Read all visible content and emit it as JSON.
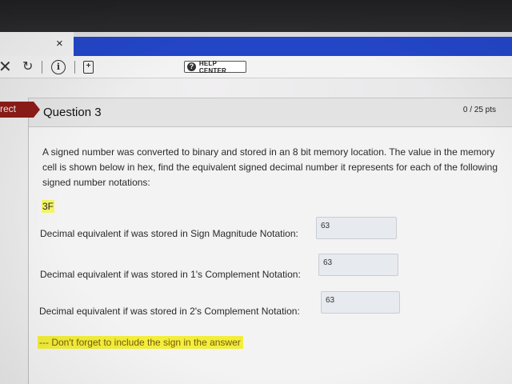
{
  "browser": {
    "tab_close_glyph": "×",
    "toolbar_icons": [
      "close-icon",
      "refresh-icon",
      "info-icon",
      "document-icon"
    ],
    "help_center_label": "HELP CENTER",
    "accent_color": "#2346c8"
  },
  "status": {
    "label": "rect",
    "color": "#8c1c19"
  },
  "question": {
    "title": "Question 3",
    "points": "0 / 25 pts",
    "prompt": "A signed number was converted to binary and stored in an 8 bit memory location.  The value in the memory cell is shown below in hex, find  the equivalent signed decimal number it represents for each of the following signed number notations:",
    "hex_value": "3F",
    "answers": [
      {
        "label": "Decimal equivalent if was stored in Sign Magnitude Notation:",
        "value": "63"
      },
      {
        "label": "Decimal equivalent if was stored in 1's Complement Notation:",
        "value": "63"
      },
      {
        "label": "Decimal equivalent if was stored in 2's Complement Notation:",
        "value": "63"
      }
    ],
    "note": "--- Don't forget to include the sign in the answer",
    "highlight_color": "#f2ee3a"
  }
}
